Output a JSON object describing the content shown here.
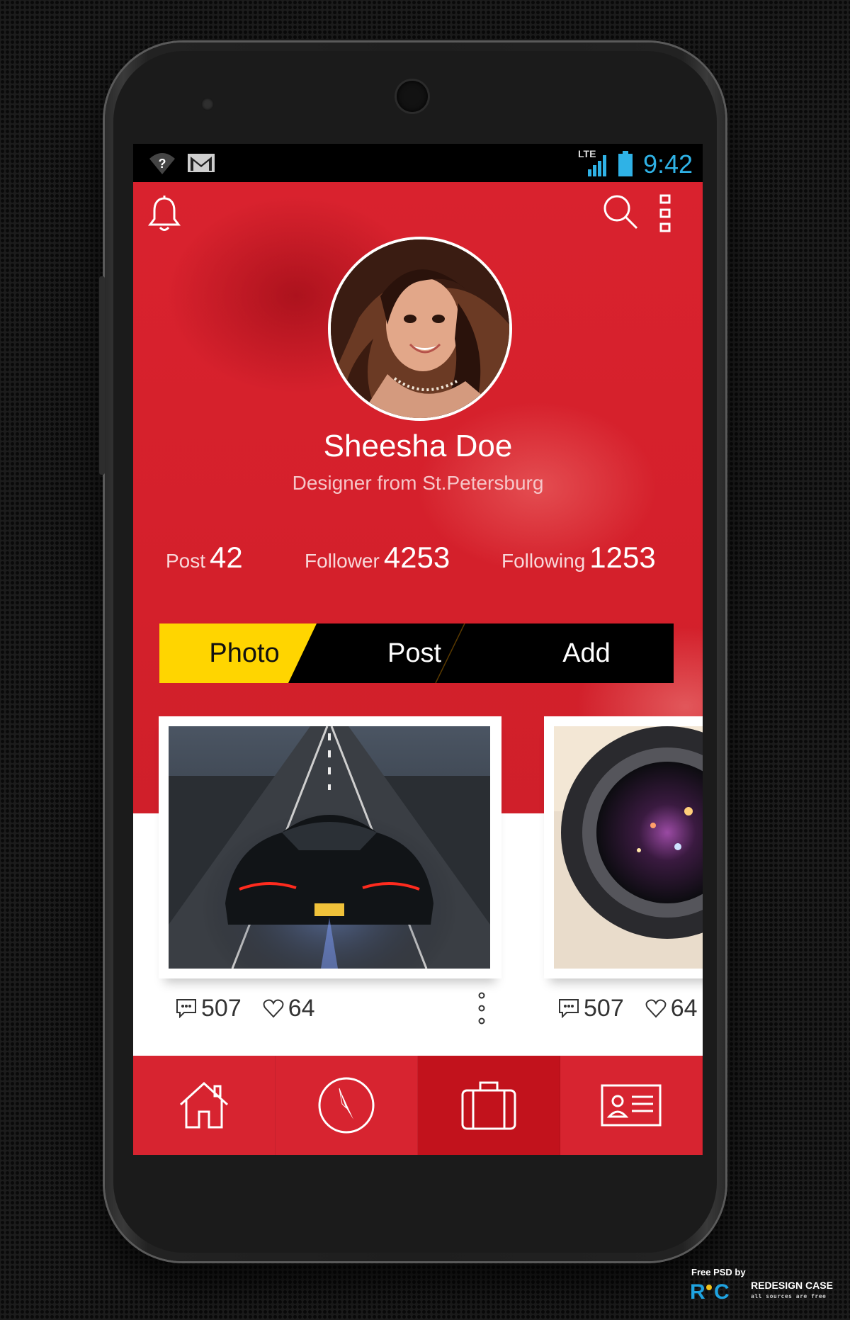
{
  "status_bar": {
    "network": "LTE",
    "time": "9:42",
    "time_color": "#2fb2e6"
  },
  "header": {
    "left_icon": "bell-icon",
    "right_icons": [
      "search-icon",
      "more-vertical-icon"
    ]
  },
  "profile": {
    "name": "Sheesha Doe",
    "subtitle": "Designer from St.Petersburg"
  },
  "stats": [
    {
      "label": "Post",
      "value": "42"
    },
    {
      "label": "Follower",
      "value": "4253"
    },
    {
      "label": "Following",
      "value": "1253"
    }
  ],
  "tabs": {
    "items": [
      "Photo",
      "Post",
      "Add"
    ],
    "active": "Photo",
    "active_color": "#ffd500"
  },
  "cards": [
    {
      "image": "sports car on road",
      "comments": "507",
      "likes": "64"
    },
    {
      "image": "camera lens",
      "comments": "507",
      "likes": "64"
    }
  ],
  "bottom_nav": {
    "items": [
      "home-icon",
      "compass-icon",
      "briefcase-icon",
      "id-card-icon"
    ],
    "active": "briefcase-icon"
  },
  "credit": {
    "line1": "Free PSD by",
    "brand": "REDESIGN CASE",
    "tagline": "all sources are free"
  },
  "colors": {
    "primary_red": "#d72430",
    "active_nav_red": "#c2121c",
    "tab_yellow": "#ffd500"
  }
}
